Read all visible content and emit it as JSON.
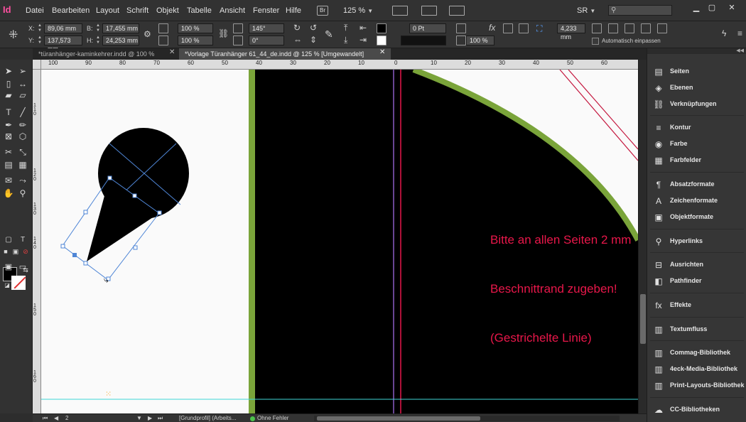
{
  "app": {
    "logo": "Id",
    "menus": [
      "Datei",
      "Bearbeiten",
      "Layout",
      "Schrift",
      "Objekt",
      "Tabelle",
      "Ansicht",
      "Fenster",
      "Hilfe"
    ],
    "bridge_badge": "Br",
    "zoom": "125 %",
    "workspace": "SR",
    "search_placeholder": ""
  },
  "control": {
    "x_label": "X:",
    "x_value": "89,06 mm",
    "y_label": "Y:",
    "y_value": "137,573 mm",
    "w_label": "B:",
    "w_value": "17,455 mm",
    "h_label": "H:",
    "h_value": "24,253 mm",
    "scale_x": "100 %",
    "scale_y": "100 %",
    "rotate": "145°",
    "shear": "0°",
    "stroke_weight": "0 Pt",
    "opacity": "100 %",
    "offset": "4,233 mm",
    "auto_fit_label": "Automatisch einpassen"
  },
  "tabs": [
    {
      "label": "*türanhänger-kaminkehrer.indd @ 100 %",
      "active": false
    },
    {
      "label": "*Vorlage Türanhänger 61_44_de.indd @ 125 % [Umgewandelt]",
      "active": true
    }
  ],
  "ruler": {
    "h_labels": [
      "100",
      "90",
      "80",
      "70",
      "60",
      "50",
      "40",
      "30",
      "20",
      "10",
      "0",
      "10",
      "20",
      "30",
      "40",
      "50",
      "60"
    ],
    "v_labels": [
      "1 1 0",
      "1 2 0",
      "1 3 0",
      "1 4 0",
      "1 5 0",
      "1 6 0"
    ]
  },
  "canvas": {
    "note_line1": "Bitte an allen Seiten 2 mm",
    "note_line2": "Beschnittrand zugeben!",
    "note_line3": "(Gestrichelte Linie)",
    "colors": {
      "background": "#000000",
      "green_border": "#7aa43a",
      "bleed_red": "#e8174a",
      "guide_purple": "#8b5cc4",
      "guide_cyan": "#3fd6d6",
      "selection_blue": "#4f86d6"
    }
  },
  "status": {
    "page_number": "2",
    "profile": "[Grundprofil] (Arbeits...",
    "preflight": "Ohne Fehler"
  },
  "panels": [
    {
      "label": "Seiten",
      "icon": "pages-icon",
      "glyph": "▤"
    },
    {
      "label": "Ebenen",
      "icon": "layers-icon",
      "glyph": "◈"
    },
    {
      "label": "Verknüpfungen",
      "icon": "links-icon",
      "glyph": "⛓"
    },
    {
      "label": "Kontur",
      "icon": "stroke-icon",
      "glyph": "≡"
    },
    {
      "label": "Farbe",
      "icon": "color-icon",
      "glyph": "◉"
    },
    {
      "label": "Farbfelder",
      "icon": "swatches-icon",
      "glyph": "▦"
    },
    {
      "label": "Absatzformate",
      "icon": "paragraph-styles-icon",
      "glyph": "¶"
    },
    {
      "label": "Zeichenformate",
      "icon": "character-styles-icon",
      "glyph": "A"
    },
    {
      "label": "Objektformate",
      "icon": "object-styles-icon",
      "glyph": "▣"
    },
    {
      "label": "Hyperlinks",
      "icon": "hyperlinks-icon",
      "glyph": "⚲"
    },
    {
      "label": "Ausrichten",
      "icon": "align-icon",
      "glyph": "⊟"
    },
    {
      "label": "Pathfinder",
      "icon": "pathfinder-icon",
      "glyph": "◧"
    },
    {
      "label": "Effekte",
      "icon": "effects-icon",
      "glyph": "fx"
    },
    {
      "label": "Textumfluss",
      "icon": "text-wrap-icon",
      "glyph": "▥"
    },
    {
      "label": "Commag-Bibliothek",
      "icon": "library-icon",
      "glyph": "▥"
    },
    {
      "label": "4eck-Media-Bibliothek",
      "icon": "library-icon",
      "glyph": "▥"
    },
    {
      "label": "Print-Layouts-Bibliothek",
      "icon": "library-icon",
      "glyph": "▥"
    },
    {
      "label": "CC-Bibliotheken",
      "icon": "cc-libraries-icon",
      "glyph": "☁"
    }
  ]
}
